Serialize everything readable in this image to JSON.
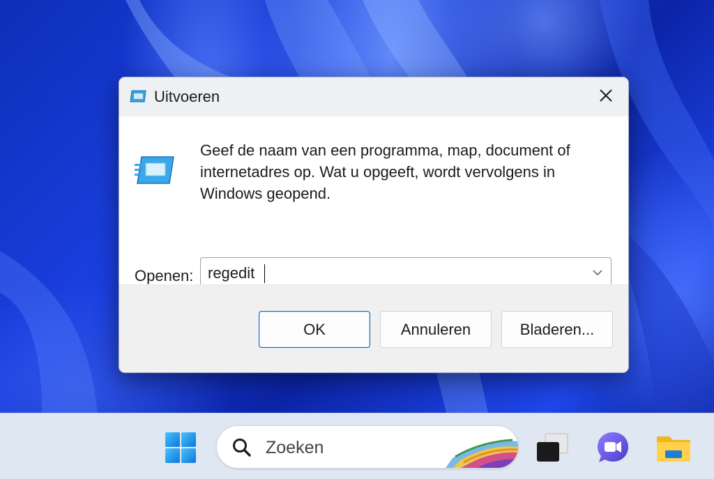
{
  "dialog": {
    "title": "Uitvoeren",
    "description": "Geef de naam van een programma, map, document of internetadres op. Wat u opgeeft, wordt vervolgens in Windows geopend.",
    "open_label": "Openen:",
    "open_value": "regedit",
    "buttons": {
      "ok": "OK",
      "cancel": "Annuleren",
      "browse": "Bladeren..."
    },
    "icons": [
      "run-icon",
      "close-icon",
      "chevron-down-icon"
    ]
  },
  "taskbar": {
    "search_placeholder": "Zoeken",
    "icons": [
      "windows-start-icon",
      "search-icon",
      "task-view-icon",
      "teams-chat-icon",
      "file-explorer-icon"
    ]
  },
  "colors": {
    "accent": "#0f6cbd",
    "wallpaper": "#1b3fe0",
    "taskbar": "#dfe7f3"
  }
}
